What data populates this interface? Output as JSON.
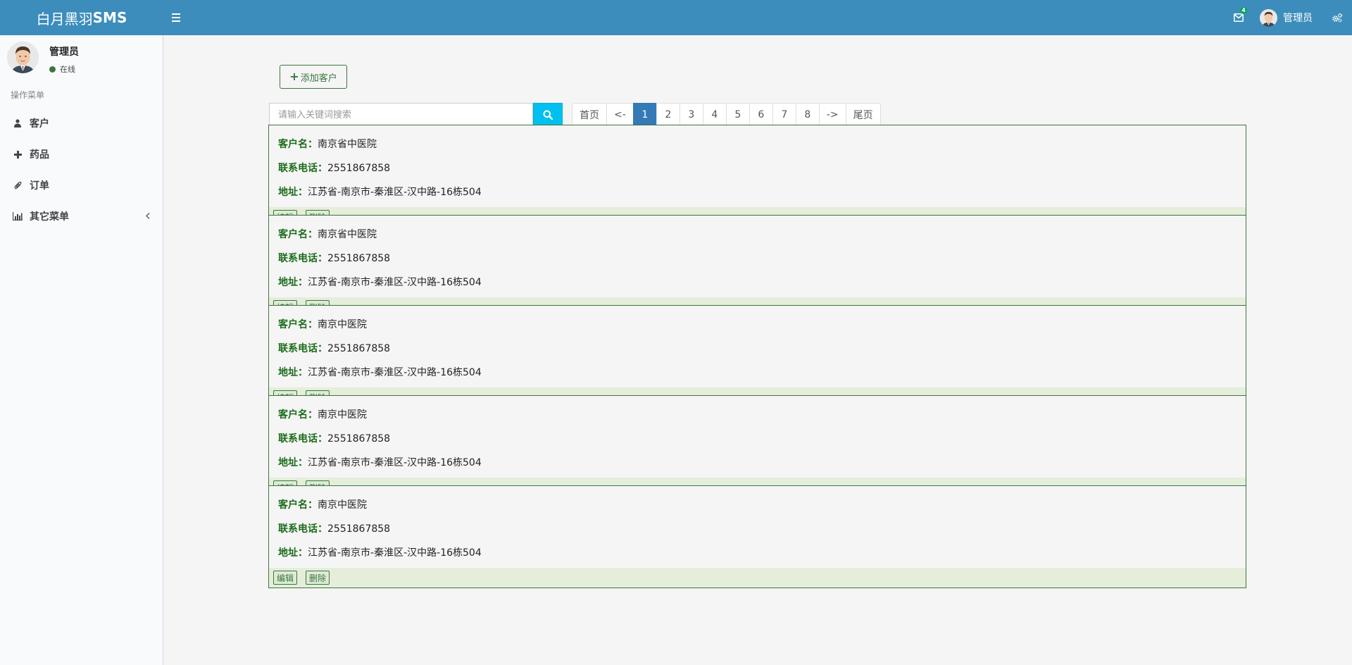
{
  "header": {
    "brand_plain": "白月黑羽",
    "brand_bold": "SMS",
    "mail_count": "4",
    "user_name": "管理员"
  },
  "sidebar": {
    "user_name": "管理员",
    "status": "在线",
    "menu_header": "操作菜单",
    "items": [
      {
        "label": "客户",
        "icon": "user-icon"
      },
      {
        "label": "药品",
        "icon": "plus-icon"
      },
      {
        "label": "订单",
        "icon": "paperclip-icon"
      },
      {
        "label": "其它菜单",
        "icon": "bar-chart-icon"
      }
    ]
  },
  "toolbar": {
    "add_label": "添加客户",
    "search_placeholder": "请输入关键词搜索"
  },
  "pagination": [
    "首页",
    "<-",
    "1",
    "2",
    "3",
    "4",
    "5",
    "6",
    "7",
    "8",
    "->",
    "尾页"
  ],
  "active_page": "1",
  "labels": {
    "name": "客户名：",
    "phone": "联系电话：",
    "address": "地址：",
    "edit": "编辑",
    "delete": "删除"
  },
  "customers": [
    {
      "name": "南京省中医院",
      "phone": "2551867858",
      "address": "江苏省-南京市-秦淮区-汉中路-16栋504"
    },
    {
      "name": "南京省中医院",
      "phone": "2551867858",
      "address": "江苏省-南京市-秦淮区-汉中路-16栋504"
    },
    {
      "name": "南京中医院",
      "phone": "2551867858",
      "address": "江苏省-南京市-秦淮区-汉中路-16栋504"
    },
    {
      "name": "南京中医院",
      "phone": "2551867858",
      "address": "江苏省-南京市-秦淮区-汉中路-16栋504"
    },
    {
      "name": "南京中医院",
      "phone": "2551867858",
      "address": "江苏省-南京市-秦淮区-汉中路-16栋504"
    }
  ],
  "colors": {
    "header": "#3c8dbc",
    "accent_green": "#3c763d",
    "active_page": "#337ab7",
    "search_button": "#00c0ef"
  }
}
